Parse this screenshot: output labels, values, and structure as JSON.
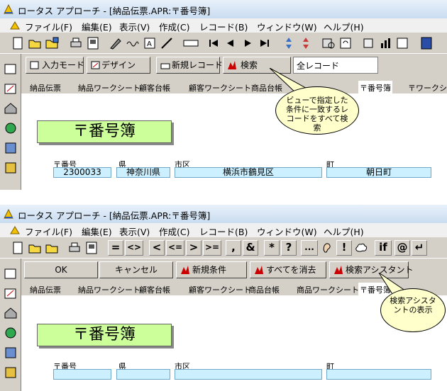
{
  "window": {
    "title": "ロータス アプローチ - [納品伝票.APR:〒番号簿]",
    "menu": [
      "ファイル(F)",
      "編集(E)",
      "表示(V)",
      "作成(C)",
      "レコード(B)",
      "ウィンドウ(W)",
      "ヘルプ(H)"
    ]
  },
  "top": {
    "actions": {
      "input_mode": "入力モード",
      "design": "デザイン",
      "new_record": "新規レコード",
      "search": "検索",
      "record_select": "全レコード"
    },
    "callout": "ビューで指定した条件に一致するレコードをすべて検索"
  },
  "bottom": {
    "operators": [
      "=",
      "<>",
      "<",
      "<=",
      ">",
      ">=",
      ",",
      "&",
      "*",
      "?",
      "...",
      "!",
      "if",
      "@",
      "↵"
    ],
    "actions": {
      "ok": "OK",
      "cancel": "キャンセル",
      "new_condition": "新規条件",
      "clear_all": "すべてを消去",
      "search_assistant": "検索アシスタント"
    },
    "callout": "検索アシスタントの表示"
  },
  "tabs": [
    "納品伝票",
    "納品ワークシート",
    "顧客台帳",
    "顧客ワークシート",
    "商品台帳",
    "商品ワークシート",
    "〒番号簿",
    "〒ワークシート"
  ],
  "form": {
    "title": "〒番号簿",
    "labels": {
      "zip": "〒番号",
      "pref": "県",
      "city": "市区",
      "town": "町"
    },
    "record": {
      "zip": "2300033",
      "pref": "神奈川県",
      "city": "横浜市鶴見区",
      "town": "朝日町"
    }
  },
  "colors": {
    "form_title_bg": "#ccff99",
    "field_bg": "#ccf0ff",
    "callout_bg": "#ffffcc"
  }
}
